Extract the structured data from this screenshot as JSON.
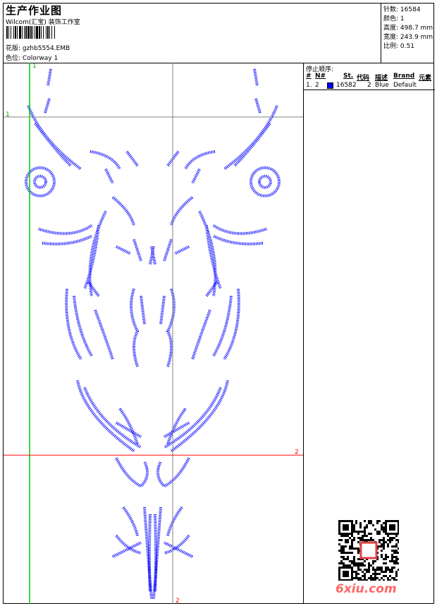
{
  "header": {
    "title": "生产作业图",
    "company": "Wilcom(汇宝) 装饰工作室",
    "design_label": "花版:",
    "design_value": "gzhb5554.EMB",
    "colorway_label": "色位:",
    "colorway_value": "Colorway 1"
  },
  "info": {
    "stitches_label": "针数:",
    "stitches_value": "16584",
    "colors_label": "颜色:",
    "colors_value": "1",
    "height_label": "高度:",
    "height_value": "498.7 mm",
    "width_label": "宽度:",
    "width_value": "243.9 mm",
    "scale_label": "比例:",
    "scale_value": "0.51"
  },
  "stop_sequence": {
    "title": "停止顺序:",
    "columns": [
      "#",
      "N#",
      "St.",
      "代码",
      "描述",
      "Brand",
      "元素"
    ],
    "rows": [
      {
        "index": "1.",
        "needle": "2",
        "color": "#0000ff",
        "stitches": "16582",
        "code": "2",
        "description": "Blue",
        "brand": "Default",
        "element": ""
      }
    ]
  },
  "guides": {
    "green_v_label": "1",
    "gray_h_label": "1",
    "red_h_label": "2",
    "gray_v_label": "2"
  },
  "colors": {
    "thread": "#0000ff",
    "guide_green": "#00cc00",
    "guide_red": "#ff0000",
    "guide_gray": "#808080",
    "watermark": "#ff6666"
  },
  "watermark": {
    "text": "6xiu.com"
  }
}
